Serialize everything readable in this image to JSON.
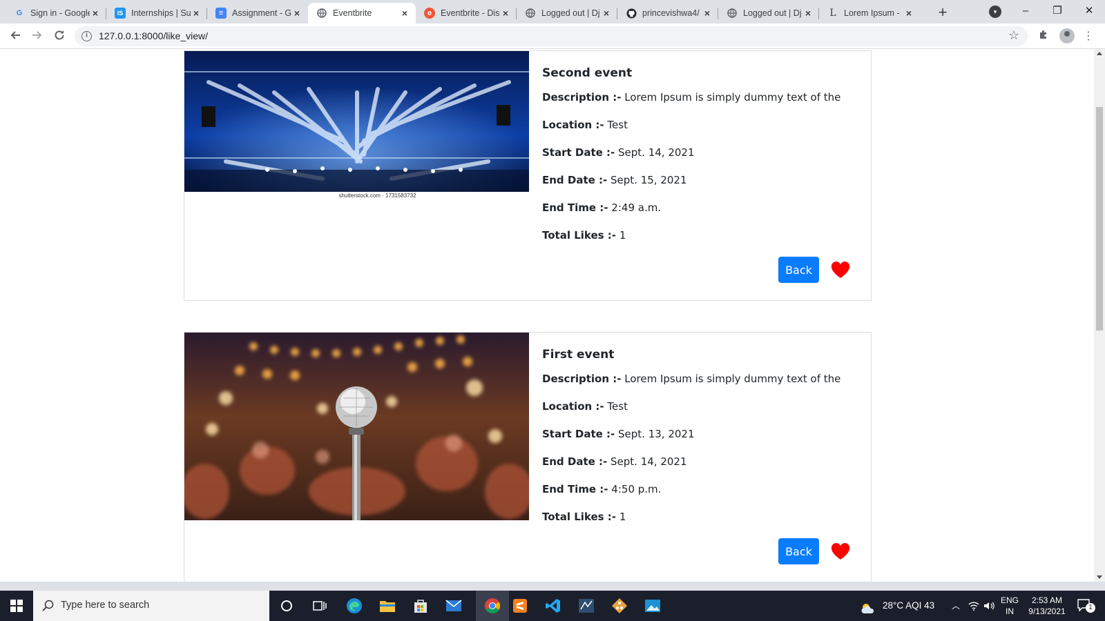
{
  "browser": {
    "tabs": [
      {
        "title": "Sign in - Google",
        "fav": "G",
        "fav_color": "#4285f4",
        "fav_bg": "transparent",
        "fav_fg": "#4285f4"
      },
      {
        "title": "Internships | Su",
        "fav": "IS",
        "fav_bg": "#2196f3",
        "fav_fg": "#ffffff"
      },
      {
        "title": "Assignment - G",
        "fav": "≡",
        "fav_bg": "#4285f4",
        "fav_fg": "#ffffff"
      },
      {
        "title": "Eventbrite",
        "fav": "◍",
        "fav_bg": "transparent",
        "fav_fg": "#5f6368"
      },
      {
        "title": "Eventbrite - Dis",
        "fav": "e",
        "fav_bg": "#f05537",
        "fav_fg": "#ffffff"
      },
      {
        "title": "Logged out | Dj",
        "fav": "◍",
        "fav_bg": "transparent",
        "fav_fg": "#5f6368"
      },
      {
        "title": "princevishwa4/",
        "fav": "●",
        "fav_bg": "transparent",
        "fav_fg": "#24292e"
      },
      {
        "title": "Logged out | Dj",
        "fav": "◍",
        "fav_bg": "transparent",
        "fav_fg": "#5f6368"
      },
      {
        "title": "Lorem Ipsum -",
        "fav": "L",
        "fav_bg": "transparent",
        "fav_fg": "#202124"
      }
    ],
    "active_tab": 3,
    "url": "127.0.0.1:8000/like_view/"
  },
  "events": [
    {
      "title": "Second event",
      "description_label": "Description :-",
      "description": "Lorem Ipsum is simply dummy text of the",
      "location_label": "Location :-",
      "location": "Test",
      "start_label": "Start Date :-",
      "start": "Sept. 14, 2021",
      "end_label": "End Date :-",
      "end": "Sept. 15, 2021",
      "time_label": "End Time :-",
      "time": "2:49 a.m.",
      "likes_label": "Total Likes :-",
      "likes": "1",
      "image_caption": "shutterstock.com · 1731583732",
      "back_label": "Back"
    },
    {
      "title": "First event",
      "description_label": "Description :-",
      "description": "Lorem Ipsum is simply dummy text of the",
      "location_label": "Location :-",
      "location": "Test",
      "start_label": "Start Date :-",
      "start": "Sept. 13, 2021",
      "end_label": "End Date :-",
      "end": "Sept. 14, 2021",
      "time_label": "End Time :-",
      "time": "4:50 p.m.",
      "likes_label": "Total Likes :-",
      "likes": "1",
      "back_label": "Back"
    }
  ],
  "colors": {
    "button": "#0a7cff",
    "heart": "#ff0000"
  },
  "taskbar": {
    "search_placeholder": "Type here to search",
    "weather": "28°C  AQI 43",
    "lang": "ENG",
    "region": "IN",
    "time": "2:53 AM",
    "date": "9/13/2021",
    "notifications": "1"
  }
}
